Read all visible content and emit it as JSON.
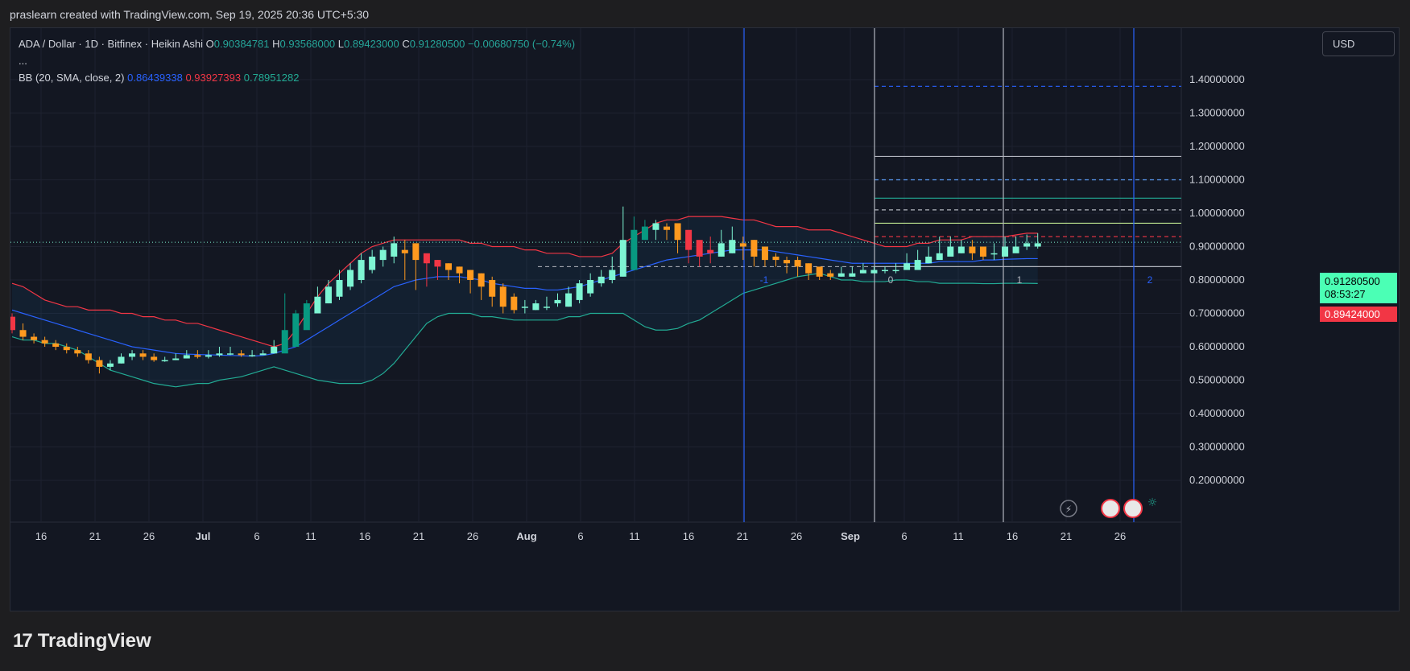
{
  "header": {
    "text": "praslearn created with TradingView.com, Sep 19, 2025 20:36 UTC+5:30"
  },
  "legend": {
    "symbol": "ADA / Dollar · 1D · Bitfinex · Heikin Ashi",
    "o_label": "O",
    "o_value": "0.90384781",
    "h_label": "H",
    "h_value": "0.93568000",
    "l_label": "L",
    "l_value": "0.89423000",
    "c_label": "C",
    "c_value": "0.91280500",
    "change": "−0.00680750 (−0.74%)",
    "more": "...",
    "bb_label": "BB (20, SMA, close, 2)",
    "bb_basis": "0.86439338",
    "bb_upper": "0.93927393",
    "bb_lower": "0.78951282"
  },
  "currency": "USD",
  "price_tags": {
    "close": "0.91280500",
    "countdown": "08:53:27",
    "low": "0.89424000"
  },
  "footer": {
    "brand": "TradingView",
    "logo_mark": "17"
  },
  "colors": {
    "up": "#7ef5d3",
    "up_hollow": "#26a69a",
    "down": "#ff9a1f",
    "down_red": "#f23645",
    "bb_basis": "#2962ff",
    "bb_upper": "#f23645",
    "bb_lower": "#22ab94"
  },
  "chart_data": {
    "type": "candlestick",
    "title": "ADA / Dollar · 1D · Bitfinex · Heikin Ashi",
    "xlabel": "",
    "ylabel": "",
    "ylim": [
      0.15,
      1.45
    ],
    "y_ticks": [
      "1.40000000",
      "1.30000000",
      "1.20000000",
      "1.10000000",
      "1.00000000",
      "0.90000000",
      "0.80000000",
      "0.70000000",
      "0.60000000",
      "0.50000000",
      "0.40000000",
      "0.30000000",
      "0.20000000"
    ],
    "x_ticks": [
      "16",
      "21",
      "26",
      "Jul",
      "6",
      "11",
      "16",
      "21",
      "26",
      "Aug",
      "6",
      "11",
      "16",
      "21",
      "26",
      "Sep",
      "6",
      "11",
      "16",
      "21",
      "26"
    ],
    "candles": {
      "open": [
        0.69,
        0.65,
        0.63,
        0.62,
        0.61,
        0.6,
        0.59,
        0.58,
        0.56,
        0.54,
        0.55,
        0.57,
        0.58,
        0.57,
        0.56,
        0.56,
        0.565,
        0.575,
        0.57,
        0.575,
        0.58,
        0.58,
        0.575,
        0.575,
        0.58,
        0.58,
        0.6,
        0.65,
        0.7,
        0.73,
        0.75,
        0.78,
        0.8,
        0.83,
        0.86,
        0.87,
        0.89,
        0.91,
        0.88,
        0.86,
        0.85,
        0.84,
        0.83,
        0.82,
        0.8,
        0.78,
        0.75,
        0.72,
        0.71,
        0.72,
        0.73,
        0.72,
        0.74,
        0.76,
        0.79,
        0.8,
        0.81,
        0.83,
        0.92,
        0.95,
        0.96,
        0.97,
        0.95,
        0.92,
        0.89,
        0.87,
        0.88,
        0.91,
        0.92,
        0.9,
        0.87,
        0.86,
        0.86,
        0.85,
        0.84,
        0.82,
        0.81,
        0.81,
        0.82,
        0.82,
        0.83,
        0.83,
        0.83,
        0.83,
        0.85,
        0.86,
        0.87,
        0.88,
        0.9,
        0.9,
        0.88,
        0.87,
        0.88,
        0.9,
        0.9
      ],
      "close": [
        0.65,
        0.63,
        0.62,
        0.61,
        0.6,
        0.59,
        0.58,
        0.56,
        0.54,
        0.55,
        0.57,
        0.58,
        0.57,
        0.56,
        0.56,
        0.565,
        0.575,
        0.57,
        0.575,
        0.58,
        0.58,
        0.575,
        0.575,
        0.58,
        0.6,
        0.65,
        0.7,
        0.73,
        0.75,
        0.78,
        0.8,
        0.83,
        0.86,
        0.87,
        0.89,
        0.91,
        0.88,
        0.86,
        0.85,
        0.84,
        0.83,
        0.82,
        0.8,
        0.78,
        0.75,
        0.72,
        0.71,
        0.72,
        0.73,
        0.72,
        0.74,
        0.76,
        0.79,
        0.8,
        0.81,
        0.83,
        0.92,
        0.95,
        0.96,
        0.97,
        0.95,
        0.92,
        0.89,
        0.87,
        0.88,
        0.91,
        0.92,
        0.9,
        0.87,
        0.86,
        0.86,
        0.85,
        0.84,
        0.82,
        0.81,
        0.81,
        0.82,
        0.82,
        0.83,
        0.83,
        0.83,
        0.83,
        0.85,
        0.86,
        0.87,
        0.88,
        0.9,
        0.9,
        0.88,
        0.87,
        0.88,
        0.9,
        0.9,
        0.91,
        0.91
      ],
      "high": [
        0.7,
        0.67,
        0.64,
        0.63,
        0.62,
        0.61,
        0.6,
        0.59,
        0.57,
        0.56,
        0.58,
        0.59,
        0.59,
        0.58,
        0.57,
        0.58,
        0.59,
        0.59,
        0.59,
        0.6,
        0.6,
        0.59,
        0.59,
        0.59,
        0.62,
        0.76,
        0.71,
        0.74,
        0.78,
        0.8,
        0.83,
        0.85,
        0.88,
        0.89,
        0.9,
        0.93,
        0.92,
        0.9,
        0.87,
        0.86,
        0.85,
        0.84,
        0.83,
        0.82,
        0.81,
        0.79,
        0.76,
        0.74,
        0.74,
        0.75,
        0.76,
        0.78,
        0.8,
        0.82,
        0.83,
        0.87,
        1.02,
        0.99,
        0.98,
        0.98,
        0.97,
        0.95,
        0.92,
        0.9,
        0.93,
        0.95,
        0.96,
        0.93,
        0.92,
        0.9,
        0.88,
        0.87,
        0.87,
        0.85,
        0.83,
        0.83,
        0.84,
        0.84,
        0.85,
        0.84,
        0.84,
        0.85,
        0.88,
        0.89,
        0.9,
        0.93,
        0.93,
        0.92,
        0.92,
        0.9,
        0.91,
        0.93,
        0.93,
        0.936,
        0.94
      ],
      "low": [
        0.64,
        0.62,
        0.61,
        0.6,
        0.59,
        0.58,
        0.57,
        0.55,
        0.52,
        0.53,
        0.55,
        0.56,
        0.56,
        0.555,
        0.555,
        0.56,
        0.565,
        0.565,
        0.565,
        0.57,
        0.575,
        0.57,
        0.57,
        0.575,
        0.58,
        0.59,
        0.62,
        0.66,
        0.7,
        0.73,
        0.74,
        0.77,
        0.79,
        0.82,
        0.84,
        0.85,
        0.8,
        0.77,
        0.78,
        0.8,
        0.8,
        0.79,
        0.76,
        0.74,
        0.72,
        0.7,
        0.7,
        0.7,
        0.71,
        0.71,
        0.72,
        0.72,
        0.73,
        0.75,
        0.78,
        0.79,
        0.81,
        0.9,
        0.92,
        0.92,
        0.92,
        0.88,
        0.85,
        0.84,
        0.85,
        0.87,
        0.88,
        0.86,
        0.84,
        0.84,
        0.84,
        0.82,
        0.81,
        0.8,
        0.8,
        0.8,
        0.81,
        0.81,
        0.82,
        0.82,
        0.82,
        0.82,
        0.84,
        0.85,
        0.86,
        0.87,
        0.88,
        0.88,
        0.86,
        0.86,
        0.86,
        0.87,
        0.89,
        0.89,
        0.894
      ]
    },
    "bollinger": {
      "upper": [
        0.79,
        0.78,
        0.76,
        0.74,
        0.73,
        0.72,
        0.72,
        0.71,
        0.71,
        0.71,
        0.7,
        0.7,
        0.69,
        0.69,
        0.68,
        0.68,
        0.67,
        0.67,
        0.66,
        0.65,
        0.64,
        0.63,
        0.62,
        0.61,
        0.6,
        0.61,
        0.65,
        0.7,
        0.75,
        0.79,
        0.82,
        0.85,
        0.88,
        0.9,
        0.91,
        0.92,
        0.92,
        0.92,
        0.92,
        0.92,
        0.92,
        0.92,
        0.91,
        0.91,
        0.9,
        0.9,
        0.9,
        0.89,
        0.89,
        0.88,
        0.88,
        0.88,
        0.87,
        0.87,
        0.87,
        0.88,
        0.91,
        0.93,
        0.95,
        0.97,
        0.98,
        0.98,
        0.99,
        0.99,
        0.99,
        0.99,
        0.985,
        0.98,
        0.98,
        0.97,
        0.96,
        0.96,
        0.96,
        0.95,
        0.95,
        0.95,
        0.94,
        0.93,
        0.92,
        0.91,
        0.9,
        0.9,
        0.9,
        0.91,
        0.91,
        0.92,
        0.92,
        0.92,
        0.93,
        0.93,
        0.93,
        0.93,
        0.935,
        0.94,
        0.94
      ],
      "basis": [
        0.71,
        0.7,
        0.69,
        0.68,
        0.67,
        0.66,
        0.65,
        0.64,
        0.63,
        0.62,
        0.61,
        0.6,
        0.595,
        0.59,
        0.585,
        0.58,
        0.578,
        0.577,
        0.576,
        0.575,
        0.574,
        0.573,
        0.572,
        0.574,
        0.58,
        0.59,
        0.6,
        0.62,
        0.64,
        0.66,
        0.68,
        0.7,
        0.72,
        0.74,
        0.76,
        0.78,
        0.79,
        0.8,
        0.805,
        0.81,
        0.81,
        0.81,
        0.805,
        0.8,
        0.79,
        0.785,
        0.78,
        0.775,
        0.775,
        0.77,
        0.77,
        0.775,
        0.78,
        0.79,
        0.8,
        0.81,
        0.82,
        0.83,
        0.84,
        0.85,
        0.86,
        0.865,
        0.87,
        0.875,
        0.88,
        0.885,
        0.89,
        0.89,
        0.89,
        0.89,
        0.885,
        0.88,
        0.875,
        0.87,
        0.865,
        0.86,
        0.855,
        0.85,
        0.85,
        0.85,
        0.85,
        0.85,
        0.85,
        0.85,
        0.85,
        0.855,
        0.855,
        0.855,
        0.855,
        0.86,
        0.86,
        0.862,
        0.863,
        0.864,
        0.864
      ],
      "lower": [
        0.63,
        0.62,
        0.62,
        0.61,
        0.61,
        0.6,
        0.59,
        0.57,
        0.55,
        0.53,
        0.52,
        0.51,
        0.5,
        0.49,
        0.485,
        0.48,
        0.485,
        0.49,
        0.49,
        0.5,
        0.505,
        0.51,
        0.52,
        0.53,
        0.54,
        0.53,
        0.52,
        0.51,
        0.5,
        0.495,
        0.49,
        0.49,
        0.49,
        0.5,
        0.52,
        0.55,
        0.59,
        0.63,
        0.67,
        0.69,
        0.7,
        0.7,
        0.7,
        0.69,
        0.69,
        0.685,
        0.68,
        0.68,
        0.68,
        0.68,
        0.68,
        0.69,
        0.69,
        0.7,
        0.7,
        0.7,
        0.7,
        0.68,
        0.66,
        0.65,
        0.65,
        0.655,
        0.67,
        0.68,
        0.7,
        0.72,
        0.74,
        0.76,
        0.77,
        0.78,
        0.79,
        0.8,
        0.81,
        0.815,
        0.82,
        0.81,
        0.8,
        0.8,
        0.795,
        0.795,
        0.795,
        0.8,
        0.8,
        0.795,
        0.795,
        0.79,
        0.79,
        0.79,
        0.79,
        0.789,
        0.789,
        0.79,
        0.79,
        0.79,
        0.7895
      ]
    },
    "fib_levels": [
      {
        "value": 1.38,
        "style": "dashed",
        "color": "#2962ff"
      },
      {
        "value": 1.17,
        "style": "solid",
        "color": "#b2b5be"
      },
      {
        "value": 1.1,
        "style": "dashed",
        "color": "#5b9cf6"
      },
      {
        "value": 1.01,
        "style": "dashed",
        "color": "#b2b5be"
      },
      {
        "value": 1.045,
        "style": "solid",
        "color": "#22ab94"
      },
      {
        "value": 0.97,
        "style": "solid",
        "color": "#c0e890"
      },
      {
        "value": 0.93,
        "style": "dashed",
        "color": "#f23645"
      },
      {
        "value": 0.84,
        "style": "solid",
        "color": "#b2b5be"
      }
    ],
    "time_cycles": [
      {
        "label": "-1",
        "color": "#2962ff"
      },
      {
        "label": "0",
        "color": "#b2b5be"
      },
      {
        "label": "1",
        "color": "#b2b5be"
      },
      {
        "label": "2",
        "color": "#2962ff"
      }
    ],
    "last_close": 0.912805
  }
}
